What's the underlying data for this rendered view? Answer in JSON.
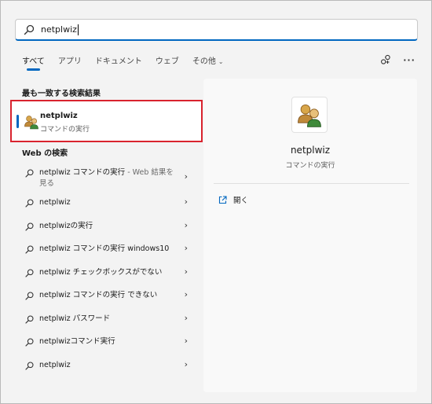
{
  "search": {
    "value": "netplwiz"
  },
  "tabs": [
    {
      "label": "すべて"
    },
    {
      "label": "アプリ"
    },
    {
      "label": "ドキュメント"
    },
    {
      "label": "ウェブ"
    },
    {
      "label": "その他"
    }
  ],
  "best_match": {
    "heading": "最も一致する検索結果",
    "name": "netplwiz",
    "subtitle": "コマンドの実行"
  },
  "web": {
    "heading": "Web の検索",
    "results": [
      {
        "main": "netplwiz コマンドの実行",
        "extra": " - Web 結果を見る"
      },
      {
        "main": "netplwiz",
        "extra": ""
      },
      {
        "main": "netplwizの実行",
        "extra": ""
      },
      {
        "main": "netplwiz コマンドの実行 windows10",
        "extra": ""
      },
      {
        "main": "netplwiz チェックボックスがでない",
        "extra": ""
      },
      {
        "main": "netplwiz コマンドの実行 できない",
        "extra": ""
      },
      {
        "main": "netplwiz パスワード",
        "extra": ""
      },
      {
        "main": "netplwizコマンド実行",
        "extra": ""
      },
      {
        "main": "netplwiz",
        "extra": ""
      }
    ]
  },
  "detail": {
    "title": "netplwiz",
    "subtitle": "コマンドの実行",
    "open_label": "開く"
  },
  "colors": {
    "accent": "#0067c0",
    "highlight_border": "#d9232e"
  }
}
